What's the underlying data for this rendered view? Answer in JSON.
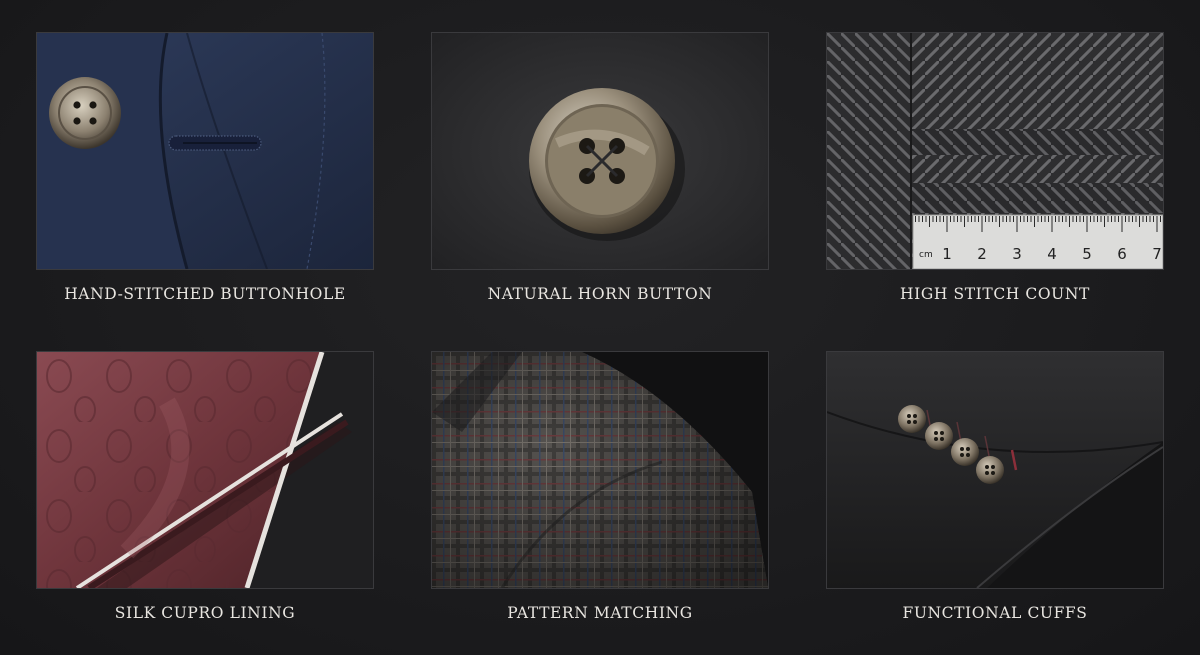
{
  "tiles": [
    {
      "caption": "HAND-STITCHED BUTTONHOLE",
      "subject": "navy wool jacket lapel with horn button and buttonhole"
    },
    {
      "caption": "NATURAL HORN BUTTON",
      "subject": "horn button on dark charcoal flannel"
    },
    {
      "caption": "HIGH STITCH COUNT",
      "subject": "herringbone fabric with measuring ruler",
      "ruler": {
        "unit": "cm",
        "marks": [
          "1",
          "2",
          "3",
          "4",
          "5",
          "6",
          "7"
        ]
      }
    },
    {
      "caption": "SILK CUPRO LINING",
      "subject": "burgundy paisley lining with white piping"
    },
    {
      "caption": "PATTERN MATCHING",
      "subject": "glen check jacket shoulder"
    },
    {
      "caption": "FUNCTIONAL CUFFS",
      "subject": "jacket sleeve with four cuff buttons"
    }
  ],
  "colors": {
    "background": "#1c1c1e",
    "caption_text": "#e9e6e1",
    "navy": "#24314d",
    "charcoal": "#2b2b2d",
    "burgundy": "#7c3e45"
  }
}
